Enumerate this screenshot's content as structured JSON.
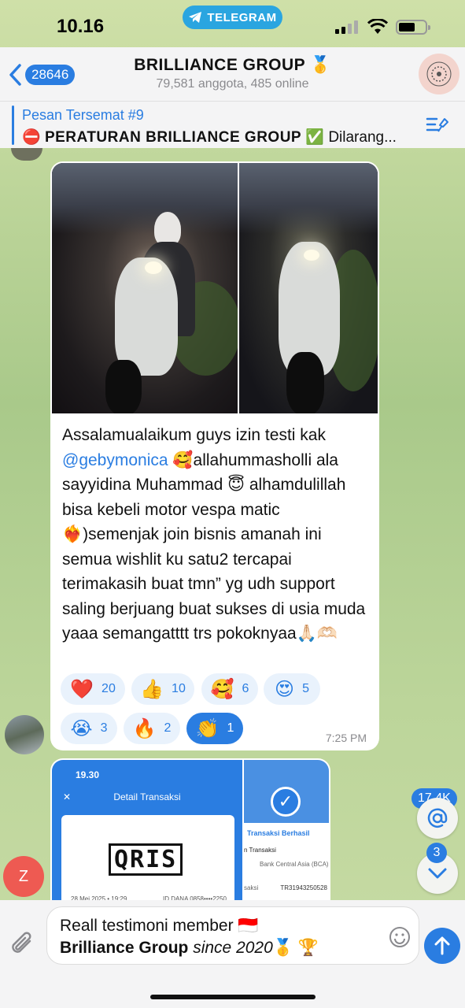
{
  "status_bar": {
    "time": "10.16",
    "app_pill": "TELEGRAM"
  },
  "header": {
    "back_count": "28646",
    "title": "BRILLIANCE GROUP 🥇",
    "subtitle": "79,581 anggota, 485 online"
  },
  "pinned": {
    "title": "Pesan Tersemat #9",
    "prefix": "⛔",
    "bold": "PERATURAN BRILLIANCE GROUP",
    "suffix": "✅ Dilarang..."
  },
  "message": {
    "text_before": "Assalamualaikum guys izin testi kak ",
    "mention": "@gebymonica",
    "text_after": " 🥰allahummasholli ala sayyidina Muhammad 😇 alhamdulillah bisa kebeli motor vespa matic❤️‍🔥)semenjak join bisnis amanah ini semua wishlit ku satu2 tercapai terimakasih buat tmn” yg udh support saling berjuang buat sukses di usia muda yaaa semangatttt trs pokoknyaa🙏🏻🫶🏻",
    "time": "7:25 PM",
    "reactions": [
      {
        "emoji": "❤️",
        "count": "20"
      },
      {
        "emoji": "👍",
        "count": "10"
      },
      {
        "emoji": "🥰",
        "count": "6"
      },
      {
        "emoji": "😍",
        "count": "5"
      },
      {
        "emoji": "😭",
        "count": "3"
      },
      {
        "emoji": "🔥",
        "count": "2"
      },
      {
        "emoji": "👏",
        "count": "1"
      }
    ]
  },
  "preview": {
    "left_time": "19.30",
    "left_header": "Detail Transaksi",
    "left_close": "✕",
    "qris": "QRIS",
    "date": "28 Mei 2025 • 19:29",
    "dana_id": "ID DANA 0858••••2250",
    "right_title": "Transaksi Berhasil",
    "right_line1": "n Transaksi",
    "right_bank": "Bank Central Asia (BCA)",
    "right_line3": "saksi",
    "right_ref": "TR31943250528"
  },
  "floating": {
    "mentions": "17.4K",
    "unread": "3",
    "z_avatar": "Z"
  },
  "input": {
    "line1": "Reall testimoni member 🇮🇩",
    "line2_bold": "Brilliance Group",
    "line2_italic": " since 2020",
    "line2_emoji": "🥇 🏆"
  },
  "colors": {
    "accent": "#2a7de1",
    "telegram_pill": "#2aa5e0",
    "avatar_z": "#ee5a52"
  },
  "icons": [
    "back-chevron-icon",
    "telegram-icon",
    "signal-icon",
    "wifi-icon",
    "battery-icon",
    "pin-list-icon",
    "mention-at-icon",
    "scroll-down-icon",
    "attach-clip-icon",
    "sticker-smiley-icon",
    "send-arrow-icon"
  ]
}
